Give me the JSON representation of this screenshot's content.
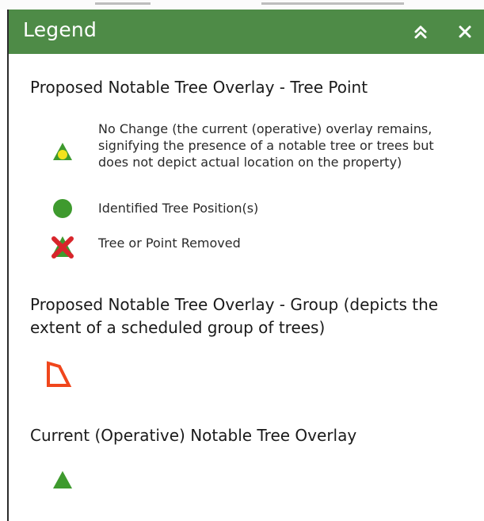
{
  "header": {
    "title": "Legend",
    "collapse_icon": "double-chevron-up-icon",
    "close_icon": "close-icon"
  },
  "sections": [
    {
      "title": "Proposed Notable Tree Overlay - Tree Point",
      "items": [
        {
          "symbol": "triangle-with-yellow-circle-icon",
          "label": "No Change (the current (operative) overlay remains, signifying the presence of a notable tree or trees but does not depict actual location on the property)"
        },
        {
          "symbol": "green-circle-icon",
          "label": "Identified Tree Position(s)"
        },
        {
          "symbol": "triangle-with-red-x-icon",
          "label": "Tree or Point Removed"
        }
      ]
    },
    {
      "title": "Proposed Notable Tree Overlay - Group (depicts the extent of a scheduled group of trees)",
      "items": [
        {
          "symbol": "orange-polygon-outline-icon",
          "label": ""
        }
      ]
    },
    {
      "title": "Current (Operative) Notable Tree Overlay",
      "items": [
        {
          "symbol": "green-triangle-icon",
          "label": ""
        }
      ]
    }
  ],
  "colors": {
    "header_bg": "#4e8b47",
    "tree_green": "#3e9a2e",
    "marker_yellow": "#f2e21c",
    "removed_red": "#d8252b",
    "group_orange": "#f0461c"
  }
}
